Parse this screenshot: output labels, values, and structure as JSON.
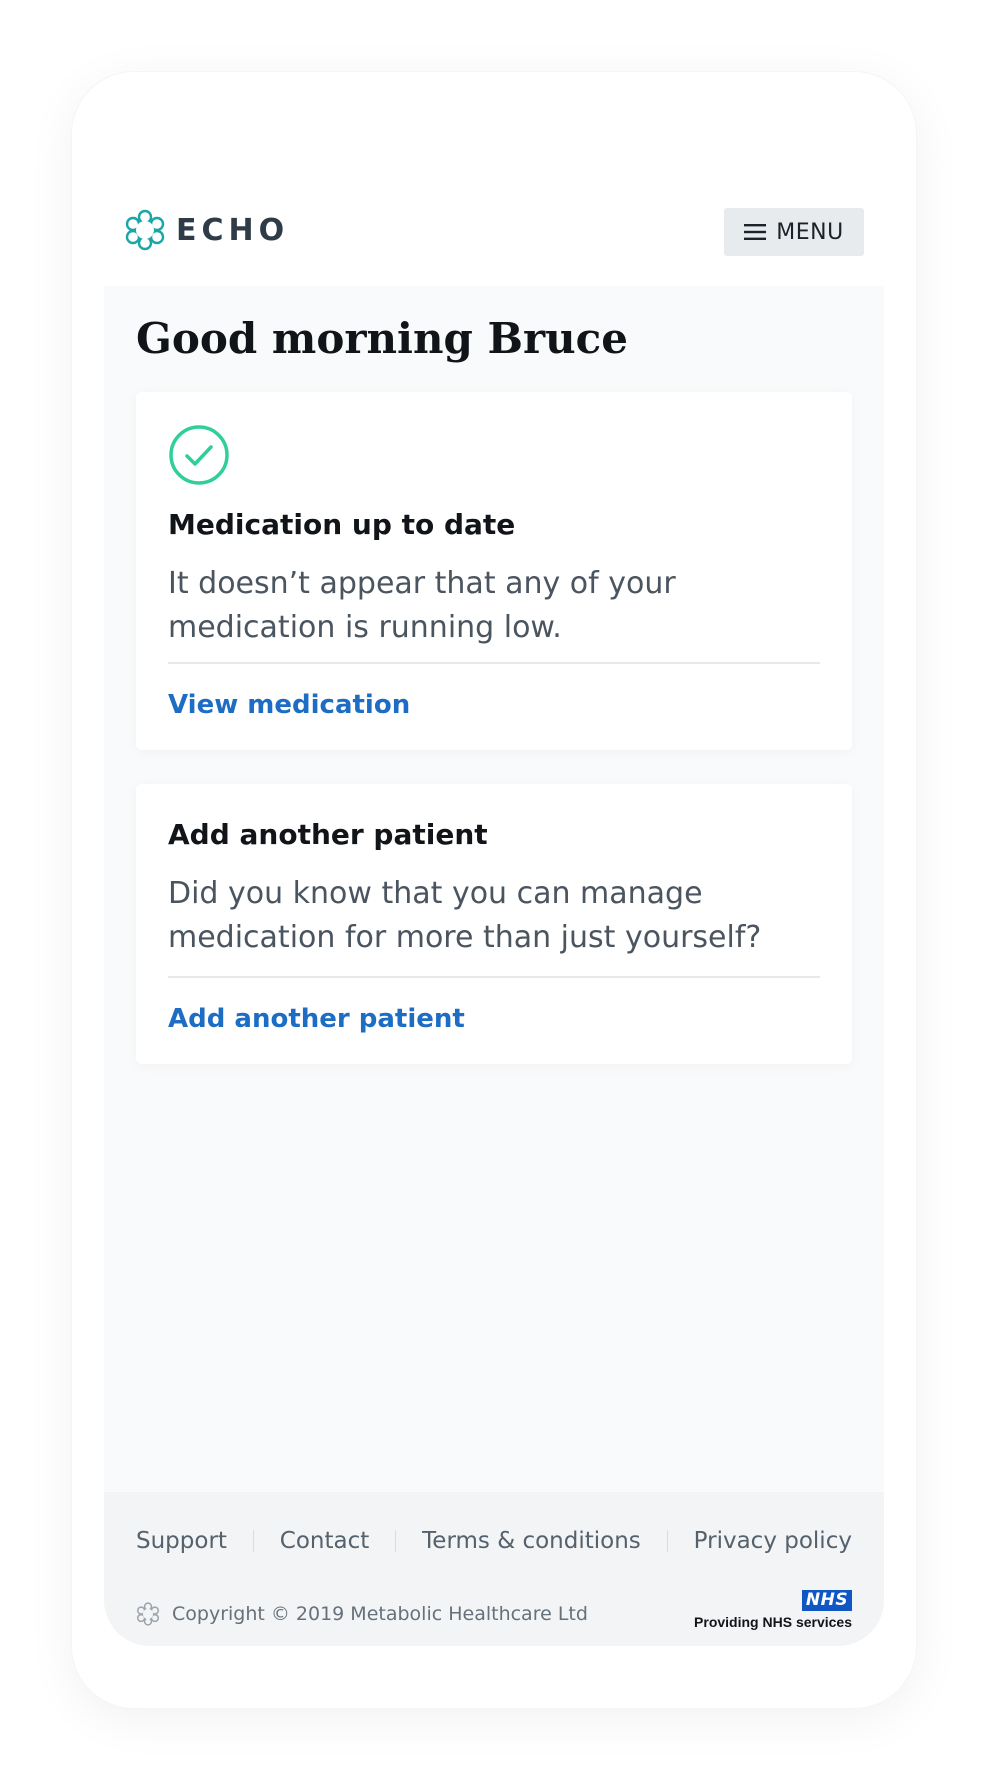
{
  "header": {
    "brand_name": "ECHO",
    "menu_label": "MENU"
  },
  "greeting": "Good morning Bruce",
  "cards": [
    {
      "icon": "check-circle-icon",
      "title": "Medication up to date",
      "body": "It doesn’t appear that any of your medication is running low.",
      "link": "View medication"
    },
    {
      "title": "Add another patient",
      "body": "Did you know that you can manage medication for more than just yourself?",
      "link": "Add another patient"
    }
  ],
  "footer": {
    "links": [
      "Support",
      "Contact",
      "Terms & conditions",
      "Privacy policy"
    ],
    "copyright": "Copyright © 2019 Metabolic Healthcare Ltd",
    "nhs_badge": "NHS",
    "nhs_text": "Providing NHS services"
  },
  "colors": {
    "brand_teal": "#1aa6a6",
    "check_green": "#2ecf9a",
    "link_blue": "#1e6dc4",
    "nhs_blue": "#1157c4"
  }
}
